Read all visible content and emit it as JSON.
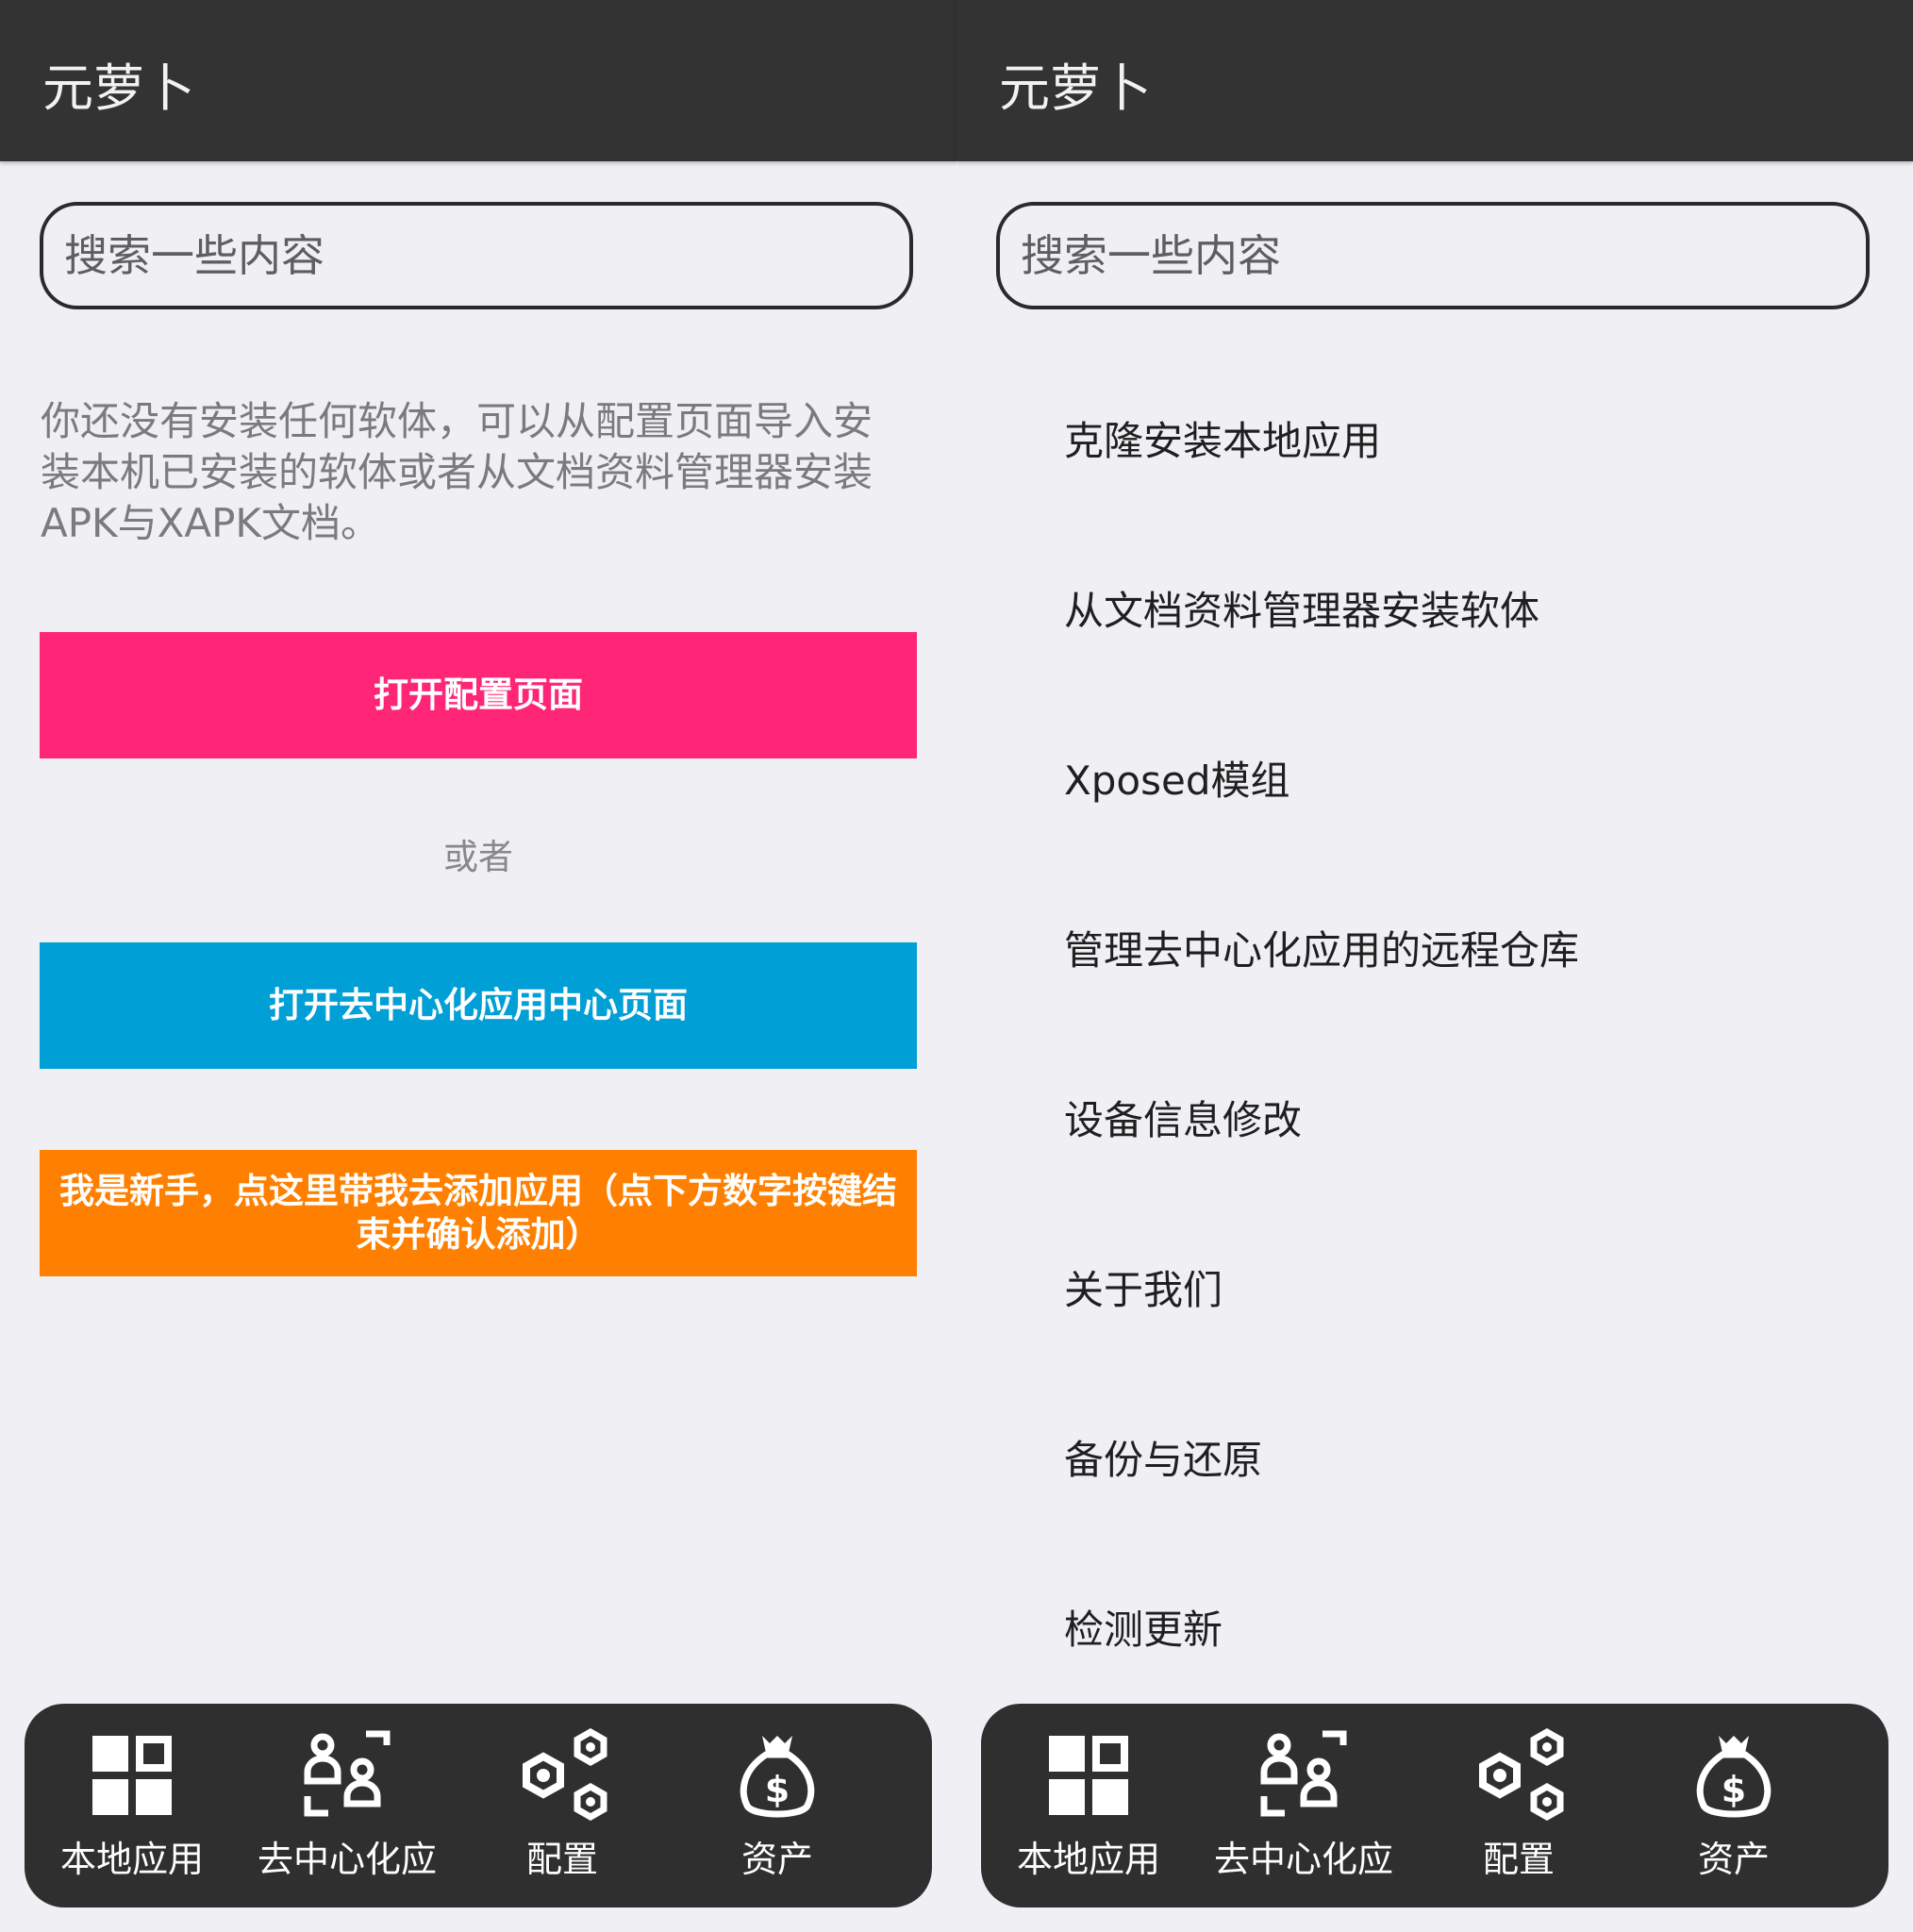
{
  "colors": {
    "appbar": "#333333",
    "background": "#f0eff3",
    "config_button": "#ff2577",
    "decentral_button": "#009fd6",
    "newbie_button": "#ff8000",
    "navbar": "#2f2f2f"
  },
  "left": {
    "title": "元萝卜",
    "search_placeholder": "搜索一些内容",
    "intro": "你还没有安装任何软体，可以从配置页面导入安装本机已安装的软体或者从文档资料管理器安装APK与XAPK文档。",
    "config_button": "打开配置页面",
    "or_label": "或者",
    "decentral_button": "打开去中心化应用中心页面",
    "newbie_button": "我是新手，点这里带我去添加应用（点下方数字按键结束并确认添加）",
    "nav": [
      {
        "label": "本地应用",
        "icon": "grid-icon"
      },
      {
        "label": "去中心化应",
        "icon": "people-icon"
      },
      {
        "label": "配置",
        "icon": "hexagon-nuts-icon"
      },
      {
        "label": "资产",
        "icon": "money-bag-icon"
      }
    ]
  },
  "right": {
    "title": "元萝卜",
    "search_placeholder": "搜索一些内容",
    "menu": [
      "克隆安装本地应用",
      "从文档资料管理器安装软体",
      "Xposed模组",
      "管理去中心化应用的远程仓库",
      "设备信息修改",
      "关于我们",
      "备份与还原",
      "检测更新"
    ],
    "nav": [
      {
        "label": "本地应用",
        "icon": "grid-icon"
      },
      {
        "label": "去中心化应",
        "icon": "people-icon"
      },
      {
        "label": "配置",
        "icon": "hexagon-nuts-icon"
      },
      {
        "label": "资产",
        "icon": "money-bag-icon"
      }
    ]
  }
}
